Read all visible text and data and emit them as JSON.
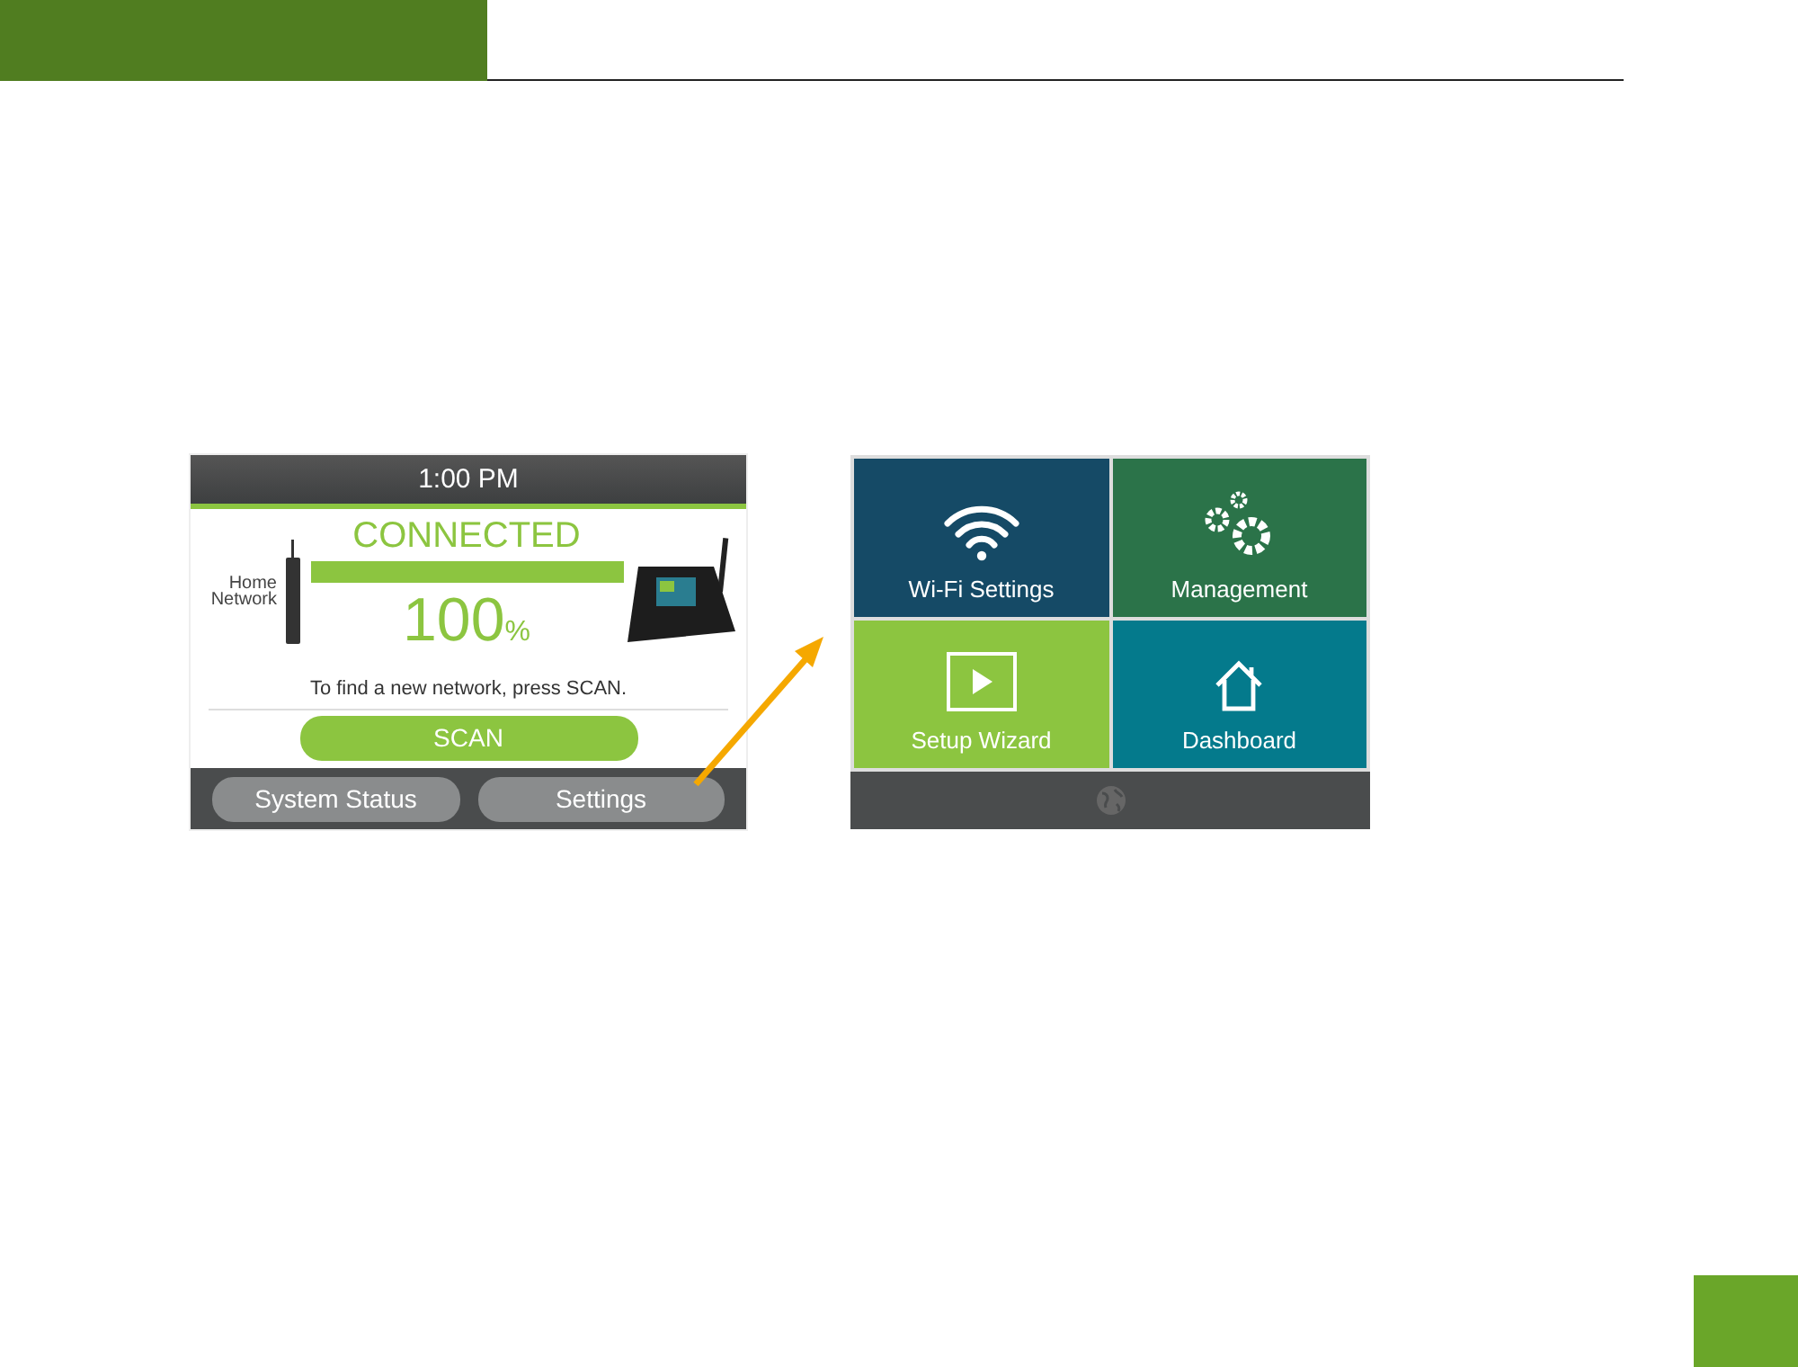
{
  "left_screen": {
    "time": "1:00 PM",
    "status": "CONNECTED",
    "home_label": "Home Network",
    "signal": {
      "level": 1.0
    },
    "percent": "100",
    "percent_unit": "%",
    "hint": "To find a new network, press SCAN.",
    "scan_button": "SCAN",
    "bottom_buttons": [
      "System Status",
      "Settings"
    ]
  },
  "right_screen": {
    "tiles": [
      {
        "label": "Wi-Fi Settings",
        "kind": "wifi",
        "color": "#154a66"
      },
      {
        "label": "Management",
        "kind": "gears",
        "color": "#2b7349"
      },
      {
        "label": "Setup Wizard",
        "kind": "play",
        "color": "#8cc540"
      },
      {
        "label": "Dashboard",
        "kind": "home",
        "color": "#047a8c"
      }
    ]
  }
}
